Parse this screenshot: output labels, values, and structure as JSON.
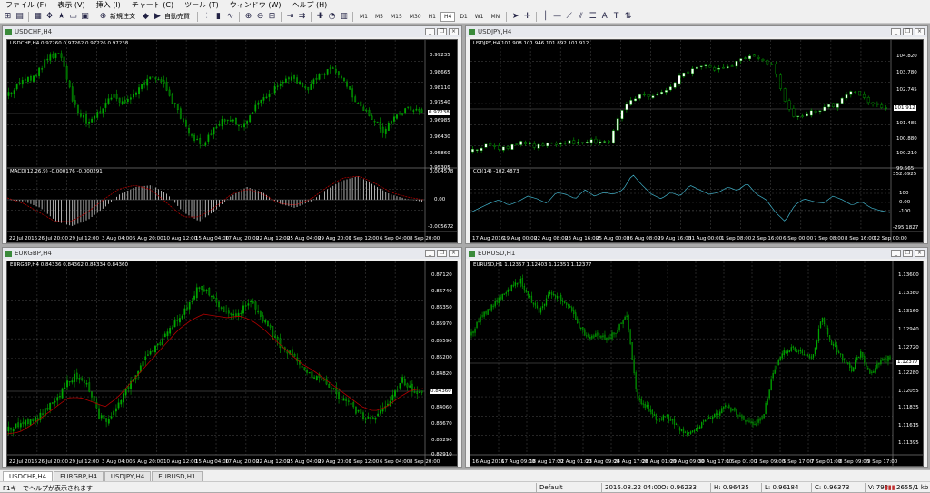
{
  "menu": [
    "ファイル (F)",
    "表示 (V)",
    "挿入 (I)",
    "チャート (C)",
    "ツール (T)",
    "ウィンドウ (W)",
    "ヘルプ (H)"
  ],
  "toolbar": {
    "new_order": "新規注文",
    "auto_trading": "自動売買",
    "timeframes": [
      "M1",
      "M5",
      "M15",
      "M30",
      "H1",
      "H4",
      "D1",
      "W1",
      "MN"
    ],
    "active_timeframe": "H4",
    "tool_t": "T",
    "tool_a": "A"
  },
  "windows": {
    "usdchf": {
      "title": "USDCHF,H4",
      "info": "USDCHF,H4  0.97260 0.97262 0.97226 0.97238",
      "main_prices": [
        "0.99235",
        "0.98665",
        "0.98110",
        "0.97540",
        "0.96985",
        "0.96430",
        "0.95860",
        "0.95305"
      ],
      "current": "0.97238",
      "sub_info": "MACD(12,26,9) -0.000176 -0.000291",
      "sub_prices": [
        "0.004578",
        "0.00",
        "-0.005672"
      ],
      "xlabels": [
        "22 Jul 2016",
        "26 Jul 20:00",
        "29 Jul 12:00",
        "3 Aug 04:00",
        "5 Aug 20:00",
        "10 Aug 12:00",
        "15 Aug 04:00",
        "17 Aug 20:00",
        "22 Aug 12:00",
        "25 Aug 04:00",
        "29 Aug 20:00",
        "1 Sep 12:00",
        "6 Sep 04:00",
        "8 Sep 20:00"
      ]
    },
    "usdjpy": {
      "title": "USDJPY,H4",
      "info": "USDJPY,H4  101.908 101.946 101.892 101.912",
      "main_prices": [
        "104.820",
        "103.780",
        "102.745",
        "101.485",
        "100.880",
        "100.210",
        "99.565"
      ],
      "current": "101.912",
      "sub_info": "CCI(14) -102.4873",
      "sub_prices": [
        "352.6925",
        "100",
        "0.00",
        "-100",
        "-295.1827"
      ],
      "xlabels": [
        "17 Aug 2016",
        "19 Aug 00:00",
        "22 Aug 08:00",
        "23 Aug 16:00",
        "25 Aug 00:00",
        "26 Aug 08:00",
        "29 Aug 16:00",
        "31 Aug 00:00",
        "1 Sep 08:00",
        "2 Sep 16:00",
        "6 Sep 00:00",
        "7 Sep 08:00",
        "8 Sep 16:00",
        "12 Sep 00:00"
      ]
    },
    "eurgbp": {
      "title": "EURGBP,H4",
      "info": "EURGBP,H4  0.84336 0.84362 0.84334 0.84360",
      "main_prices": [
        "0.87120",
        "0.86740",
        "0.86350",
        "0.85970",
        "0.85590",
        "0.85200",
        "0.84820",
        "0.84360",
        "0.84060",
        "0.83670",
        "0.83290",
        "0.82910"
      ],
      "current": "0.84360",
      "xlabels": [
        "22 Jul 2016",
        "26 Jul 20:00",
        "29 Jul 12:00",
        "3 Aug 04:00",
        "5 Aug 20:00",
        "10 Aug 12:00",
        "15 Aug 04:00",
        "17 Aug 20:00",
        "22 Aug 12:00",
        "25 Aug 04:00",
        "29 Aug 20:00",
        "1 Sep 12:00",
        "6 Sep 04:00",
        "8 Sep 20:00"
      ]
    },
    "eurusd": {
      "title": "EURUSD,H1",
      "info": "EURUSD,H1  1.12357 1.12403 1.12351 1.12377",
      "main_prices": [
        "1.13600",
        "1.13380",
        "1.13160",
        "1.12940",
        "1.12720",
        "1.12377",
        "1.12280",
        "1.12055",
        "1.11835",
        "1.11615",
        "1.11395"
      ],
      "current": "1.12377",
      "xlabels": [
        "16 Aug 2016",
        "17 Aug 09:00",
        "18 Aug 17:00",
        "22 Aug 01:00",
        "23 Aug 09:00",
        "24 Aug 17:00",
        "26 Aug 01:00",
        "29 Aug 09:00",
        "30 Aug 17:00",
        "1 Sep 01:00",
        "2 Sep 09:00",
        "5 Sep 17:00",
        "7 Sep 01:00",
        "8 Sep 09:00",
        "9 Sep 17:00"
      ]
    }
  },
  "tabs": [
    "USDCHF,H4",
    "EURGBP,H4",
    "USDJPY,H4",
    "EURUSD,H1"
  ],
  "active_tab": "USDCHF,H4",
  "status": {
    "help": "F1キーでヘルプが表示されます",
    "profile": "Default",
    "datetime": "2016.08.22 04:00",
    "open": "O: 0.96233",
    "high": "H: 0.96435",
    "low": "L: 0.96184",
    "close": "C: 0.96373",
    "volume": "V: 793",
    "traffic": "2655/1 kb"
  },
  "colors": {
    "bull": "#00a800",
    "bear": "#006600",
    "bull_solid": "#ffffff",
    "bear_solid": "#000000",
    "ma": "#b00000",
    "cci": "#3fb0c8"
  }
}
